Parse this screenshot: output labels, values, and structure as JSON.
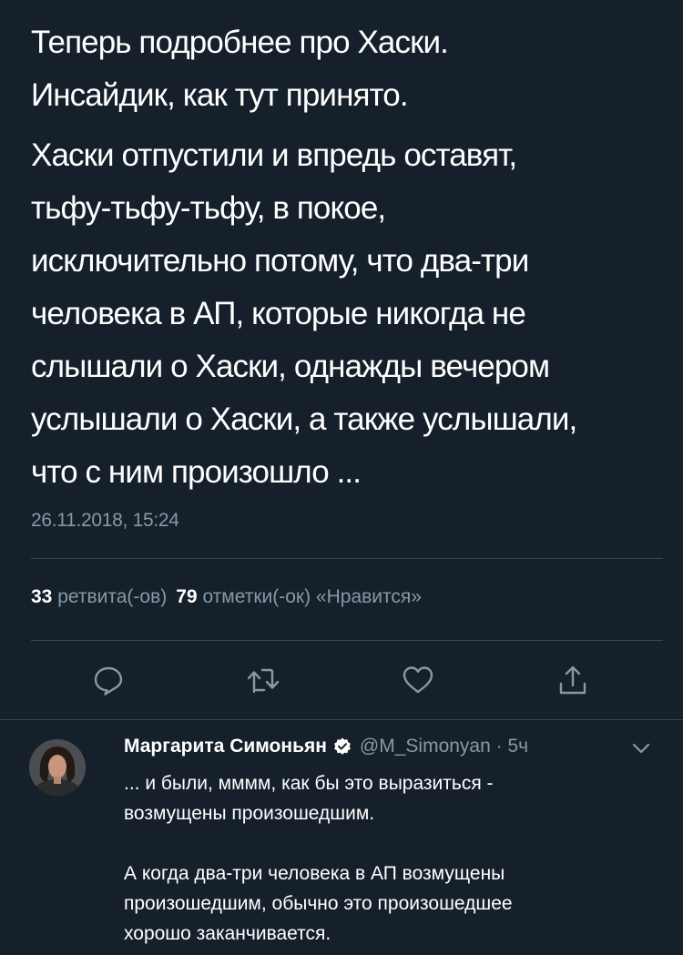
{
  "tweet": {
    "paragraph1": [
      "Теперь подробнее про Хаски.",
      "Инсайдик, как тут принято."
    ],
    "paragraph2": [
      "Хаски отпустили и впредь оставят,",
      "тьфу-тьфу-тьфу, в покое,",
      "исключительно потому, что два-три",
      "человека в АП, которые никогда не",
      "слышали о Хаски, однажды вечером",
      "услышали о Хаски, а также услышали,",
      "что с ним произошло ..."
    ],
    "timestamp": "26.11.2018, 15:24"
  },
  "stats": {
    "retweets_count": "33",
    "retweets_label": "ретвита(-ов)",
    "likes_count": "79",
    "likes_label": "отметки(-ок) «Нравится»"
  },
  "actions": [
    {
      "icon": "reply-icon"
    },
    {
      "icon": "retweet-icon"
    },
    {
      "icon": "like-icon"
    },
    {
      "icon": "share-icon"
    }
  ],
  "reply": {
    "author_name": "Маргарита Симоньян",
    "verified": true,
    "handle": "@M_Simonyan · 5ч",
    "paragraph1": [
      "... и были, мммм, как бы это выразиться -",
      "возмущены произошедшим."
    ],
    "paragraph2": [
      "А когда два-три человека в АП возмущены",
      "произошедшим, обычно это произошедшее",
      "хорошо заканчивается."
    ]
  },
  "colors": {
    "background": "#15202b",
    "text": "#ffffff",
    "secondary": "#8899a6",
    "divider": "#38444d",
    "accent": "#1da1f2"
  }
}
